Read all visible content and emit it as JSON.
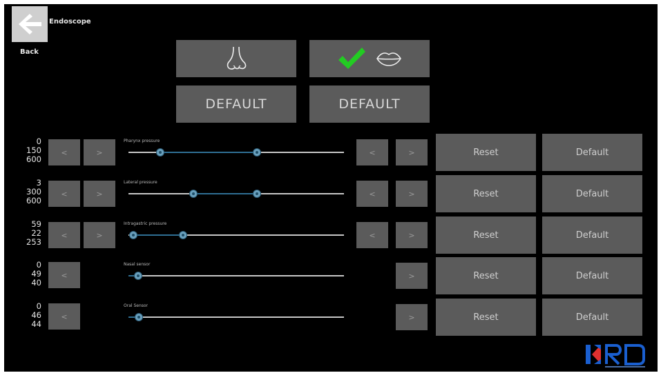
{
  "header": {
    "title": "Endoscope",
    "back_label": "Back"
  },
  "modes": {
    "nose_default_label": "DEFAULT",
    "mouth_default_label": "DEFAULT",
    "selected": "mouth"
  },
  "rows": [
    {
      "values": [
        "0",
        "150",
        "600"
      ],
      "slider_label": "Pharynx pressure",
      "reset_label": "Reset",
      "default_label": "Default",
      "left_prev": "<",
      "left_next": ">",
      "right_prev": "<",
      "right_next": ">"
    },
    {
      "values": [
        "3",
        "300",
        "600"
      ],
      "slider_label": "Lateral pressure",
      "reset_label": "Reset",
      "default_label": "Default",
      "left_prev": "<",
      "left_next": ">",
      "right_prev": "<",
      "right_next": ">"
    },
    {
      "values": [
        "59",
        "22",
        "253"
      ],
      "slider_label": "Intragastric pressure",
      "reset_label": "Reset",
      "default_label": "Default",
      "left_prev": "<",
      "left_next": ">",
      "right_prev": "<",
      "right_next": ">"
    },
    {
      "values": [
        "0",
        "49",
        "40"
      ],
      "slider_label": "Nasal sensor",
      "reset_label": "Reset",
      "default_label": "Default",
      "left_prev": "<",
      "right_next": ">"
    },
    {
      "values": [
        "0",
        "46",
        "44"
      ],
      "slider_label": "Oral Sensor",
      "reset_label": "Reset",
      "default_label": "Default",
      "left_prev": "<",
      "right_next": ">"
    }
  ],
  "icons": {
    "back": "arrow-left-icon",
    "nose": "nose-icon",
    "mouth": "lips-icon",
    "check": "checkmark-icon"
  },
  "colors": {
    "background": "#000000",
    "button": "#5b5b5b",
    "check": "#22cc22",
    "slider_fill": "#2f6f94",
    "logo_blue": "#1a5fd0",
    "logo_red": "#e03030"
  }
}
